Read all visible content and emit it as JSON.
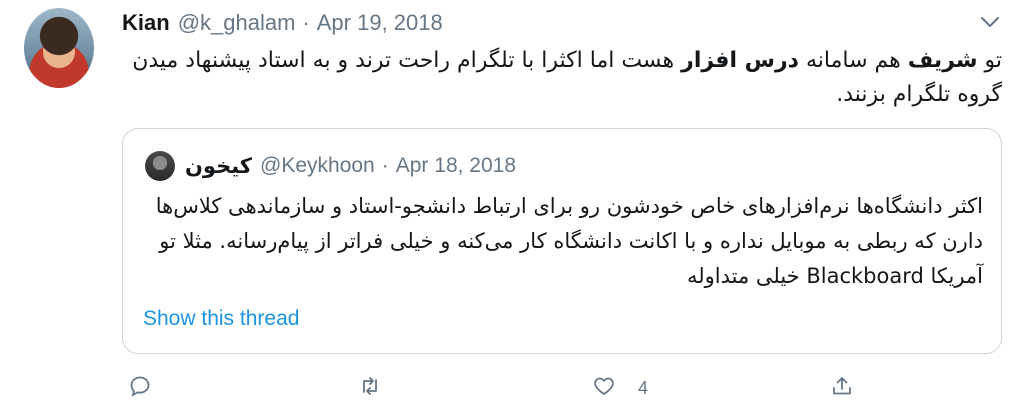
{
  "tweet": {
    "author_name": "Kian",
    "author_handle": "@k_ghalam",
    "separator": "·",
    "date": "Apr 19, 2018",
    "text_pre": "تو ",
    "text_bold1": "شریف",
    "text_mid": " هم سامانه ",
    "text_bold2": "درس افزار",
    "text_post": " هست اما اکثرا با تلگرام راحت ترند و به استاد پیشنهاد میدن گروه تلگرام بزنند."
  },
  "quoted": {
    "author_name": "کیخون",
    "author_handle": "@Keykhoon",
    "separator": "·",
    "date": "Apr 18, 2018",
    "text": "اکثر دانشگاه‌ها نرم‌افزارهای خاص خودشون رو برای ارتباط دانشجو-استاد و سازماندهی کلاس‌ها دارن که ربطی به موبایل نداره و با اکانت دانشگاه کار می‌کنه و خیلی فراتر از پیام‌رسانه. مثلا تو آمریکا Blackboard خیلی متداوله",
    "thread_link": "Show this thread"
  },
  "actions": {
    "like_count": "4"
  },
  "icons": [
    "chevron-down-icon",
    "reply-icon",
    "retweet-icon",
    "like-icon",
    "share-icon"
  ],
  "colors": {
    "link": "#1b95e0",
    "muted": "#657786",
    "border": "#ccd6dd"
  }
}
